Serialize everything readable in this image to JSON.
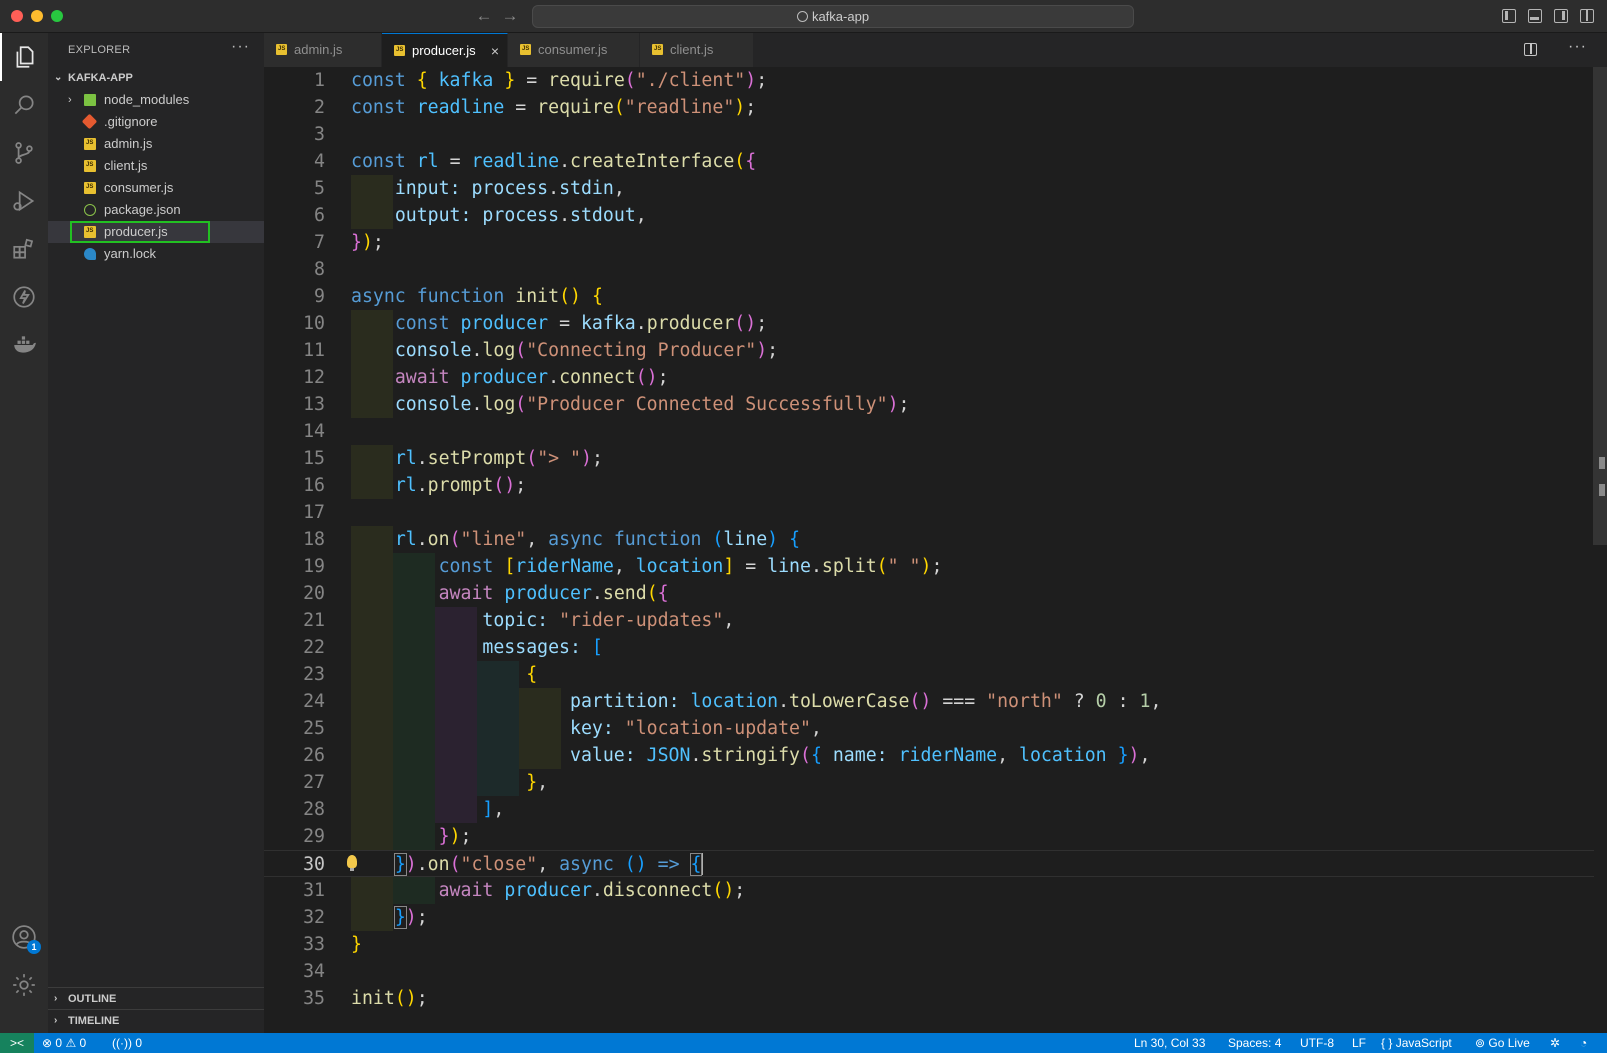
{
  "window": {
    "title": "kafka-app"
  },
  "sidebar": {
    "header": "EXPLORER",
    "root": "KAFKA-APP",
    "files": [
      {
        "name": "node_modules",
        "type": "folder"
      },
      {
        "name": ".gitignore",
        "type": "git"
      },
      {
        "name": "admin.js",
        "type": "js"
      },
      {
        "name": "client.js",
        "type": "js"
      },
      {
        "name": "consumer.js",
        "type": "js"
      },
      {
        "name": "package.json",
        "type": "json"
      },
      {
        "name": "producer.js",
        "type": "js",
        "selected": true
      },
      {
        "name": "yarn.lock",
        "type": "yarn"
      }
    ],
    "panels": [
      "OUTLINE",
      "TIMELINE"
    ]
  },
  "activity": {
    "icons": [
      "files-icon",
      "search-icon",
      "source-control-icon",
      "run-debug-icon",
      "extensions-icon",
      "thunder-client-icon",
      "docker-icon",
      "account-icon",
      "settings-gear-icon"
    ],
    "account_badge": "1"
  },
  "tabs": [
    {
      "label": "admin.js"
    },
    {
      "label": "producer.js",
      "active": true,
      "close": "×"
    },
    {
      "label": "consumer.js"
    },
    {
      "label": "client.js"
    }
  ],
  "editor": {
    "current_line": 30,
    "lines": [
      "const { kafka } = require(\"./client\");",
      "const readline = require(\"readline\");",
      "",
      "const rl = readline.createInterface({",
      "    input: process.stdin,",
      "    output: process.stdout,",
      "});",
      "",
      "async function init() {",
      "    const producer = kafka.producer();",
      "    console.log(\"Connecting Producer\");",
      "    await producer.connect();",
      "    console.log(\"Producer Connected Successfully\");",
      "",
      "    rl.setPrompt(\"> \");",
      "    rl.prompt();",
      "",
      "    rl.on(\"line\", async function (line) {",
      "        const [riderName, location] = line.split(\" \");",
      "        await producer.send({",
      "            topic: \"rider-updates\",",
      "            messages: [",
      "                {",
      "                    partition: location.toLowerCase() === \"north\" ? 0 : 1,",
      "                    key: \"location-update\",",
      "                    value: JSON.stringify({ name: riderName, location }),",
      "                },",
      "            ],",
      "        });",
      "    }).on(\"close\", async () => {",
      "        await producer.disconnect();",
      "    });",
      "}",
      "",
      "init();"
    ]
  },
  "status": {
    "remote": "><",
    "errors": "0",
    "warnings": "0",
    "ports": "0",
    "position": "Ln 30, Col 33",
    "spaces": "Spaces: 4",
    "encoding": "UTF-8",
    "eol": "LF",
    "language_braces": "{ }",
    "language": "JavaScript",
    "golive": "Go Live"
  }
}
